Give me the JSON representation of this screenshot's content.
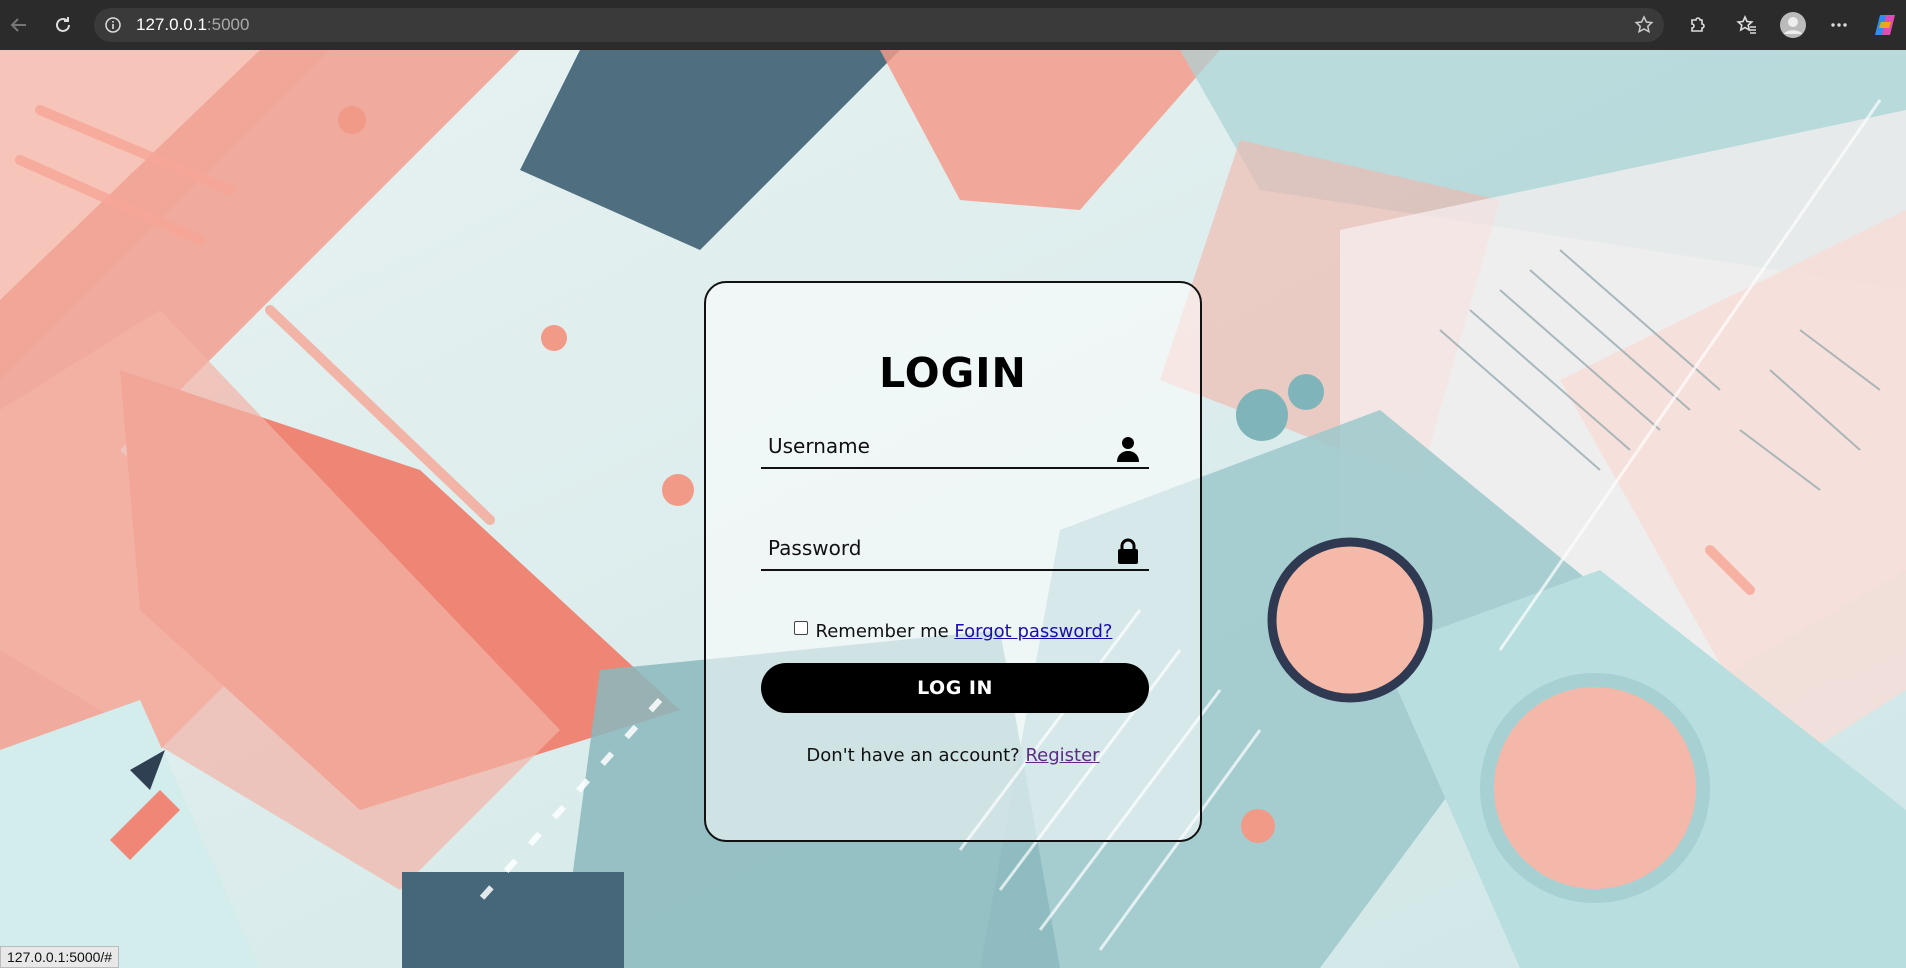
{
  "browser": {
    "url_host": "127.0.0.1",
    "url_port": ":5000",
    "icons": [
      "back-icon",
      "reload-icon",
      "info-icon",
      "star-icon",
      "extensions-icon",
      "favorites-icon",
      "profile-icon",
      "more-icon",
      "copilot-icon"
    ]
  },
  "login": {
    "title": "LOGIN",
    "username_placeholder": "Username",
    "password_placeholder": "Password",
    "remember_label": "Remember me",
    "forgot_link": "Forgot password?",
    "button_label": "LOG IN",
    "register_prompt": "Don't have an account?",
    "register_link": "Register"
  },
  "status_bar": {
    "text": "127.0.0.1:5000/#"
  },
  "colors": {
    "accent": "#000000",
    "link": "#1a0dab",
    "visited_link": "#5a2d82",
    "bg_teal": "#8fc3c6",
    "bg_salmon": "#ef8b7c"
  }
}
